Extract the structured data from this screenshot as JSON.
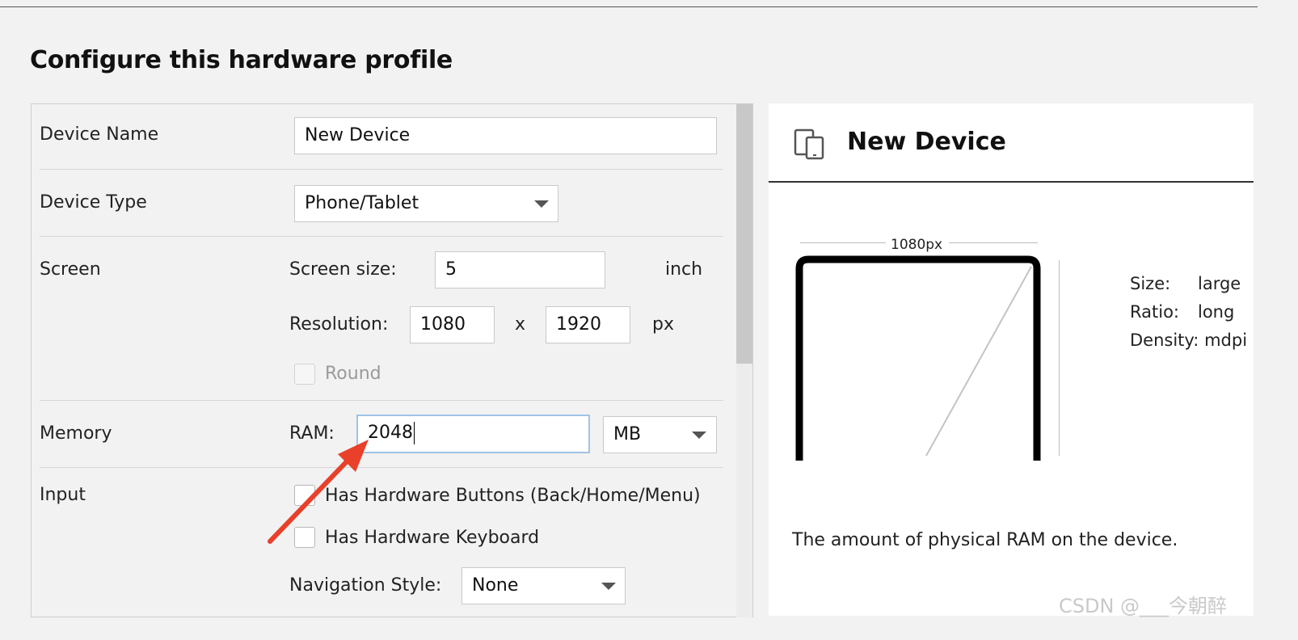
{
  "title": "Configure this hardware profile",
  "form": {
    "device_name_label": "Device Name",
    "device_name_value": "New Device",
    "device_type_label": "Device Type",
    "device_type_value": "Phone/Tablet",
    "screen_label": "Screen",
    "screen_size_label": "Screen size:",
    "screen_size_value": "5",
    "screen_size_unit": "inch",
    "resolution_label": "Resolution:",
    "resolution_width": "1080",
    "resolution_x": "x",
    "resolution_height": "1920",
    "resolution_unit": "px",
    "round_label": "Round",
    "memory_label": "Memory",
    "ram_label": "RAM:",
    "ram_value": "2048",
    "ram_unit": "MB",
    "input_label": "Input",
    "hw_buttons_label": "Has Hardware Buttons (Back/Home/Menu)",
    "hw_keyboard_label": "Has Hardware Keyboard",
    "nav_style_label": "Navigation Style:",
    "nav_style_value": "None"
  },
  "preview": {
    "device_name": "New Device",
    "width_label": "1080px",
    "size_key": "Size:",
    "size_value": "large",
    "ratio_key": "Ratio:",
    "ratio_value": "long",
    "density_key": "Density:",
    "density_value": "mdpi",
    "help_text": "The amount of physical RAM on the device."
  },
  "watermark": "CSDN @___今朝醉",
  "colors": {
    "annotation_arrow": "#e8402a",
    "focus_border": "#9fc3e8"
  },
  "icons": [
    "device-icon",
    "dropdown-arrow-icon",
    "annotation-arrow"
  ]
}
